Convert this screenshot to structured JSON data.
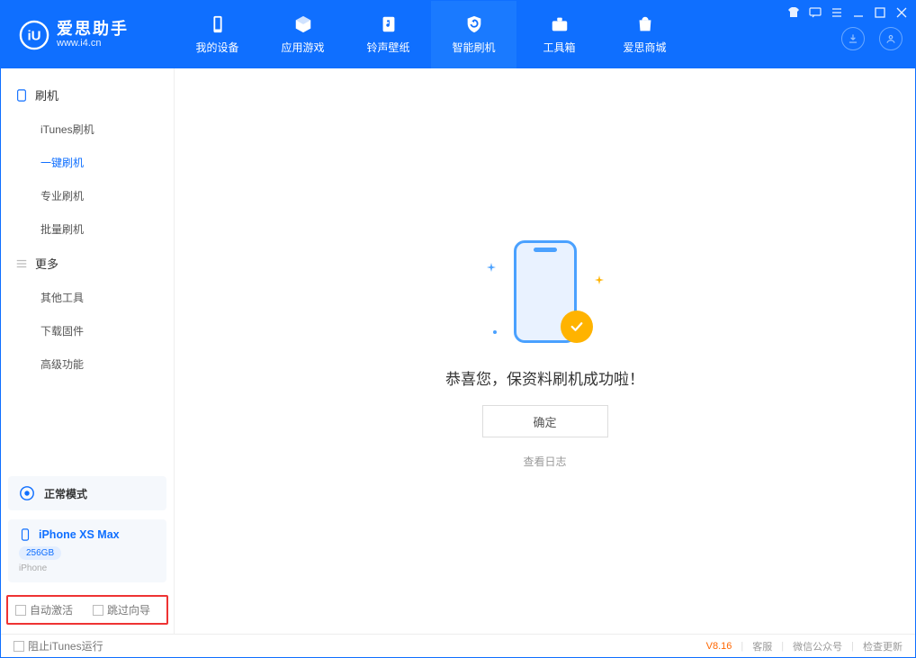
{
  "app": {
    "name_cn": "爱思助手",
    "name_en": "www.i4.cn"
  },
  "tabs": [
    {
      "label": "我的设备"
    },
    {
      "label": "应用游戏"
    },
    {
      "label": "铃声壁纸"
    },
    {
      "label": "智能刷机"
    },
    {
      "label": "工具箱"
    },
    {
      "label": "爱思商城"
    }
  ],
  "sidebar": {
    "group1": {
      "title": "刷机",
      "items": [
        "iTunes刷机",
        "一键刷机",
        "专业刷机",
        "批量刷机"
      ]
    },
    "group2": {
      "title": "更多",
      "items": [
        "其他工具",
        "下载固件",
        "高级功能"
      ]
    },
    "mode_card": {
      "label": "正常模式"
    },
    "device_card": {
      "name": "iPhone XS Max",
      "storage": "256GB",
      "sub": "iPhone"
    },
    "checks": {
      "auto_activate": "自动激活",
      "skip_guide": "跳过向导"
    }
  },
  "main": {
    "success_text": "恭喜您，保资料刷机成功啦！",
    "ok_button": "确定",
    "view_log": "查看日志"
  },
  "footer": {
    "block_itunes": "阻止iTunes运行",
    "version": "V8.16",
    "links": {
      "support": "客服",
      "wechat": "微信公众号",
      "check_update": "检查更新"
    }
  }
}
